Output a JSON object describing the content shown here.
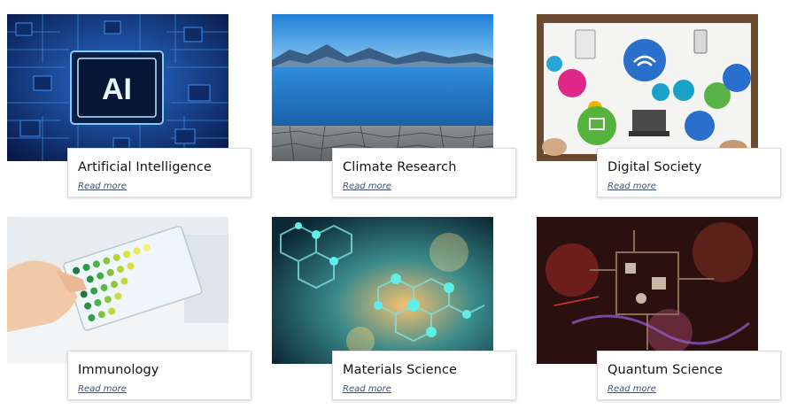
{
  "cards": [
    {
      "title": "Artificial Intelligence",
      "link": "Read more",
      "image": "ai-chip-image"
    },
    {
      "title": "Climate Research",
      "link": "Read more",
      "image": "lake-mountains-image"
    },
    {
      "title": "Digital Society",
      "link": "Read more",
      "image": "digital-icons-table-image"
    },
    {
      "title": "Immunology",
      "link": "Read more",
      "image": "well-plate-image"
    },
    {
      "title": "Materials Science",
      "link": "Read more",
      "image": "molecular-structure-image"
    },
    {
      "title": "Quantum Science",
      "link": "Read more",
      "image": "quantum-lab-image"
    }
  ],
  "ai_chip_text": "AI"
}
